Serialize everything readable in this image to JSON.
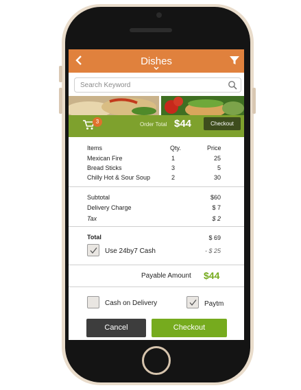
{
  "header": {
    "title": "Dishes",
    "back_icon": "chevron-left-icon",
    "filter_icon": "funnel-icon"
  },
  "search": {
    "placeholder": "Search Keyword",
    "icon": "search-icon"
  },
  "order_bar": {
    "cart_count": "3",
    "order_total_label": "Order Total",
    "order_total_value": "$44",
    "checkout_label": "Checkout"
  },
  "items_table": {
    "headers": {
      "name": "Items",
      "qty": "Qty.",
      "price": "Price"
    },
    "rows": [
      {
        "name": "Mexican Fire",
        "qty": "1",
        "price": "25"
      },
      {
        "name": "Bread Sticks",
        "qty": "3",
        "price": "5"
      },
      {
        "name": "Chilly Hot & Sour Soup",
        "qty": "2",
        "price": "30"
      }
    ]
  },
  "charges": {
    "subtotal_label": "Subtotal",
    "subtotal_value": "$60",
    "delivery_label": "Delivery Charge",
    "delivery_value": "$ 7",
    "tax_label": "Tax",
    "tax_value": "$ 2"
  },
  "total": {
    "label": "Total",
    "value": "$ 69",
    "cash_label": "Use 24by7 Cash",
    "cash_value": "- $ 25",
    "cash_checked": true
  },
  "payable": {
    "label": "Payable Amount",
    "value": "$44"
  },
  "payment": {
    "cod_label": "Cash on Delivery",
    "cod_checked": false,
    "paytm_label": "Paytm",
    "paytm_checked": true
  },
  "actions": {
    "cancel_label": "Cancel",
    "checkout_label": "Checkout"
  },
  "colors": {
    "header": "#e0813d",
    "order_bar": "#7ea12d",
    "accent_green": "#76ab1e",
    "dark": "#3d3d3d"
  }
}
